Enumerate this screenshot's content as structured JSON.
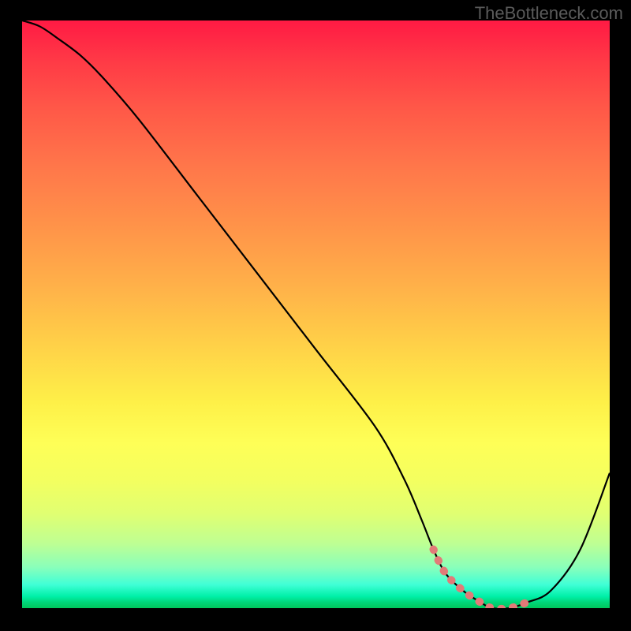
{
  "watermark": "TheBottleneck.com",
  "chart_data": {
    "type": "line",
    "title": "",
    "xlabel": "",
    "ylabel": "",
    "xlim": [
      0,
      100
    ],
    "ylim": [
      0,
      100
    ],
    "series": [
      {
        "name": "curve",
        "x": [
          0,
          3,
          6,
          10,
          14,
          20,
          30,
          40,
          50,
          60,
          65,
          68,
          70,
          72,
          75,
          78,
          80,
          83,
          86,
          90,
          95,
          100
        ],
        "values": [
          100,
          99,
          97,
          94,
          90,
          83,
          70,
          57,
          44,
          31,
          22,
          15,
          10,
          6,
          3,
          1,
          0,
          0,
          1,
          3,
          10,
          23
        ]
      }
    ],
    "highlight_region": {
      "x_start": 70,
      "x_end": 86,
      "color": "#e27a78"
    },
    "background_gradient": {
      "top": "#ff1a44",
      "mid": "#fef048",
      "bottom": "#00c65c"
    }
  }
}
